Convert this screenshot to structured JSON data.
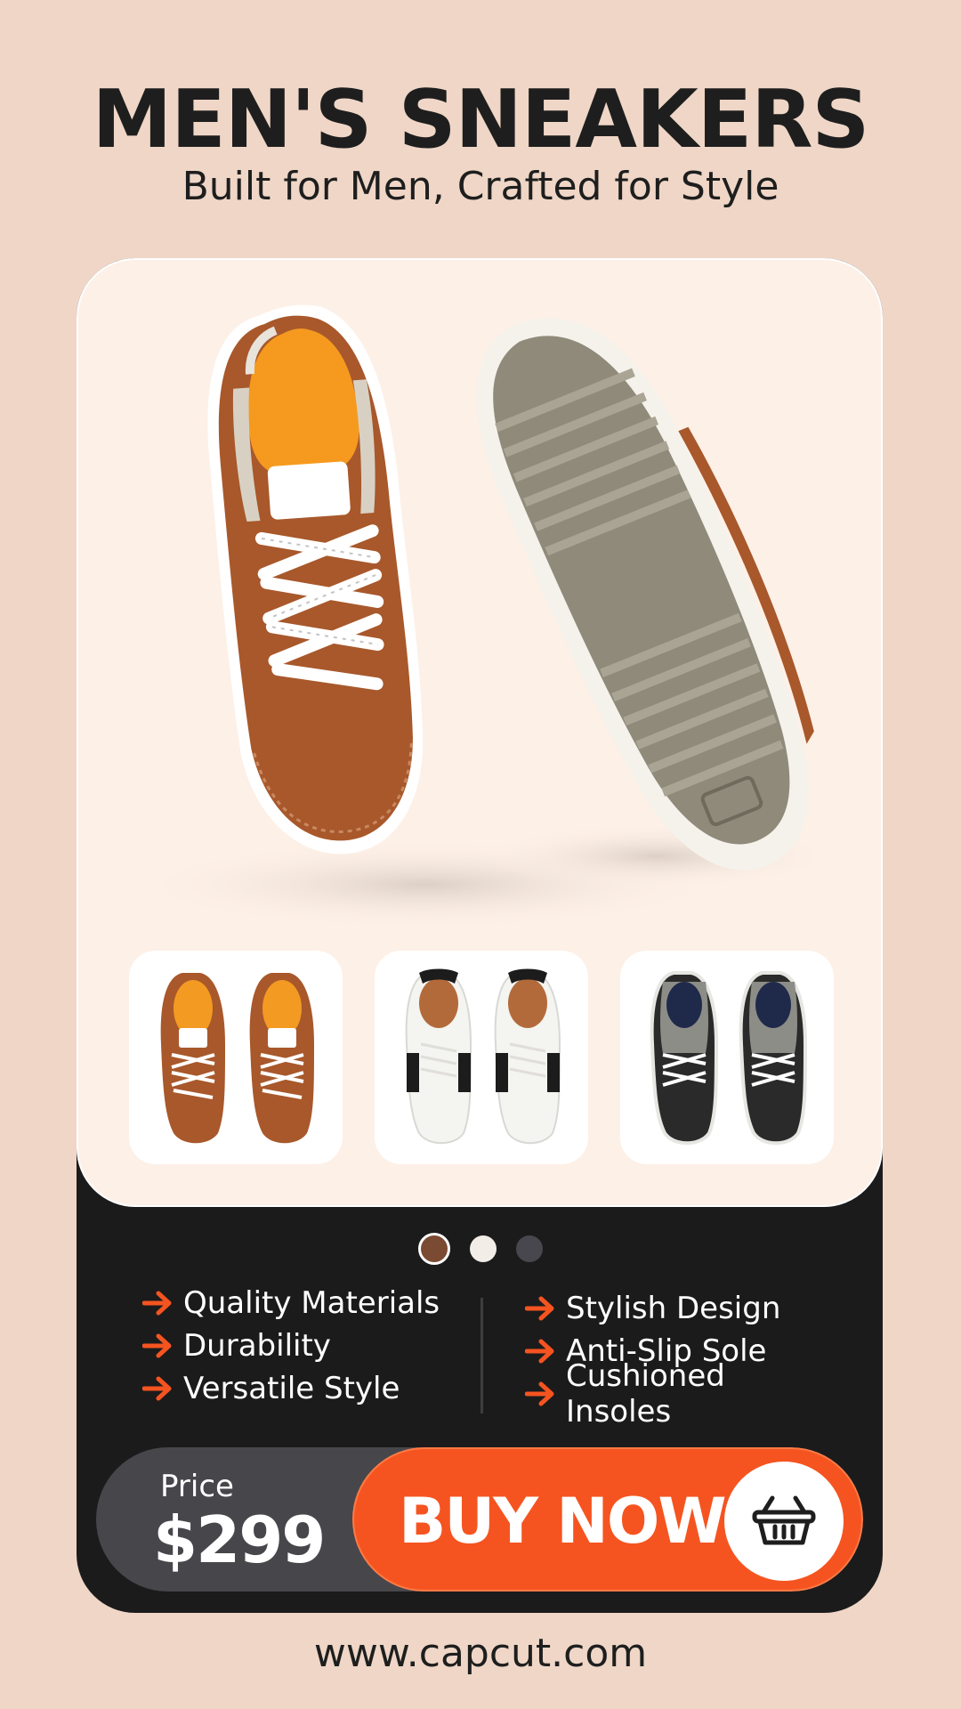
{
  "header": {
    "title": "MEN'S SNEAKERS",
    "subtitle": "Built for Men, Crafted for Style"
  },
  "product": {
    "hero_image": "brown-leather-sneakers-icon",
    "thumbnails": [
      {
        "name": "brown-sneakers-icon",
        "upper": "#a8582b",
        "accent": "#ffffff",
        "lining": "#f39a22"
      },
      {
        "name": "white-black-sneakers-icon",
        "upper": "#f4f4f0",
        "accent": "#1c1c1c",
        "lining": "#b36a3a"
      },
      {
        "name": "black-grey-sneakers-icon",
        "upper": "#2a2a2a",
        "accent": "#8d8d88",
        "lining": "#1f2a4a"
      }
    ],
    "color_options": [
      {
        "name": "brown",
        "color": "#7b4a32",
        "selected": true
      },
      {
        "name": "white",
        "color": "#f2ede7",
        "selected": false
      },
      {
        "name": "dark",
        "color": "#48474d",
        "selected": false
      }
    ]
  },
  "features": {
    "left": [
      "Quality Materials",
      "Durability",
      "Versatile Style"
    ],
    "right": [
      "Stylish Design",
      "Anti-Slip Sole",
      "Cushioned Insoles"
    ]
  },
  "cta": {
    "price_label": "Price",
    "price_value": "$299",
    "buy_label": "BUY NOW",
    "basket_icon": "shopping-basket-icon"
  },
  "footer": {
    "url": "www.capcut.com"
  },
  "colors": {
    "background": "#efd6c6",
    "card_dark": "#1c1b1c",
    "card_light": "#fdf0e7",
    "accent": "#f55420",
    "price_pill": "#47464b"
  }
}
